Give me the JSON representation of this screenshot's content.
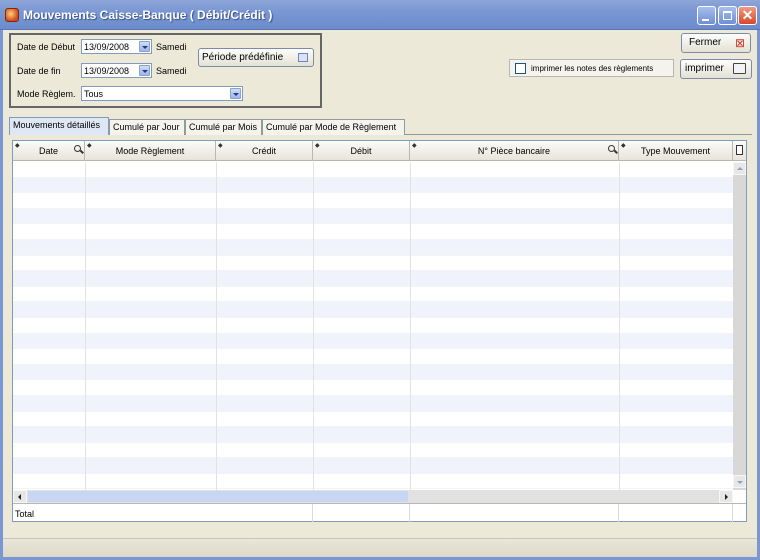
{
  "window": {
    "title": "Mouvements Caisse-Banque ( Débit/Crédit )"
  },
  "filters": {
    "start_date_label": "Date de Début",
    "start_date_value": "13/09/2008",
    "start_day": "Samedi",
    "end_date_label": "Date de fin",
    "end_date_value": "13/09/2008",
    "end_day": "Samedi",
    "payment_mode_label": "Mode Règlem.",
    "payment_mode_value": "Tous",
    "preset_period_label": "Période prédéfinie"
  },
  "actions": {
    "close_label": "Fermer",
    "print_notes_label": "imprimer les notes des règlements",
    "print_notes_checked": false,
    "print_label": "imprimer"
  },
  "tabs": [
    {
      "label": "Mouvements détaillés",
      "active": true
    },
    {
      "label": "Cumulé par Jour",
      "active": false
    },
    {
      "label": "Cumulé par Mois",
      "active": false
    },
    {
      "label": "Cumulé par Mode de Règlement",
      "active": false
    }
  ],
  "grid": {
    "columns": [
      "Date",
      "Mode Règlement",
      "Crédit",
      "Débit",
      "N° Pièce bancaire",
      "Type Mouvement"
    ],
    "rows": [],
    "total_label": "Total"
  },
  "colors": {
    "titlebar": "#7a97d3",
    "row_stripe": "#f0f3fb",
    "active_tab": "#dfe7f5"
  },
  "icons": [
    "app-icon",
    "minimize-icon",
    "maximize-icon",
    "close-icon",
    "dropdown-arrow-icon",
    "calendar-icon",
    "close-red-x-icon",
    "printer-icon",
    "search-icon",
    "column-chooser-icon"
  ]
}
